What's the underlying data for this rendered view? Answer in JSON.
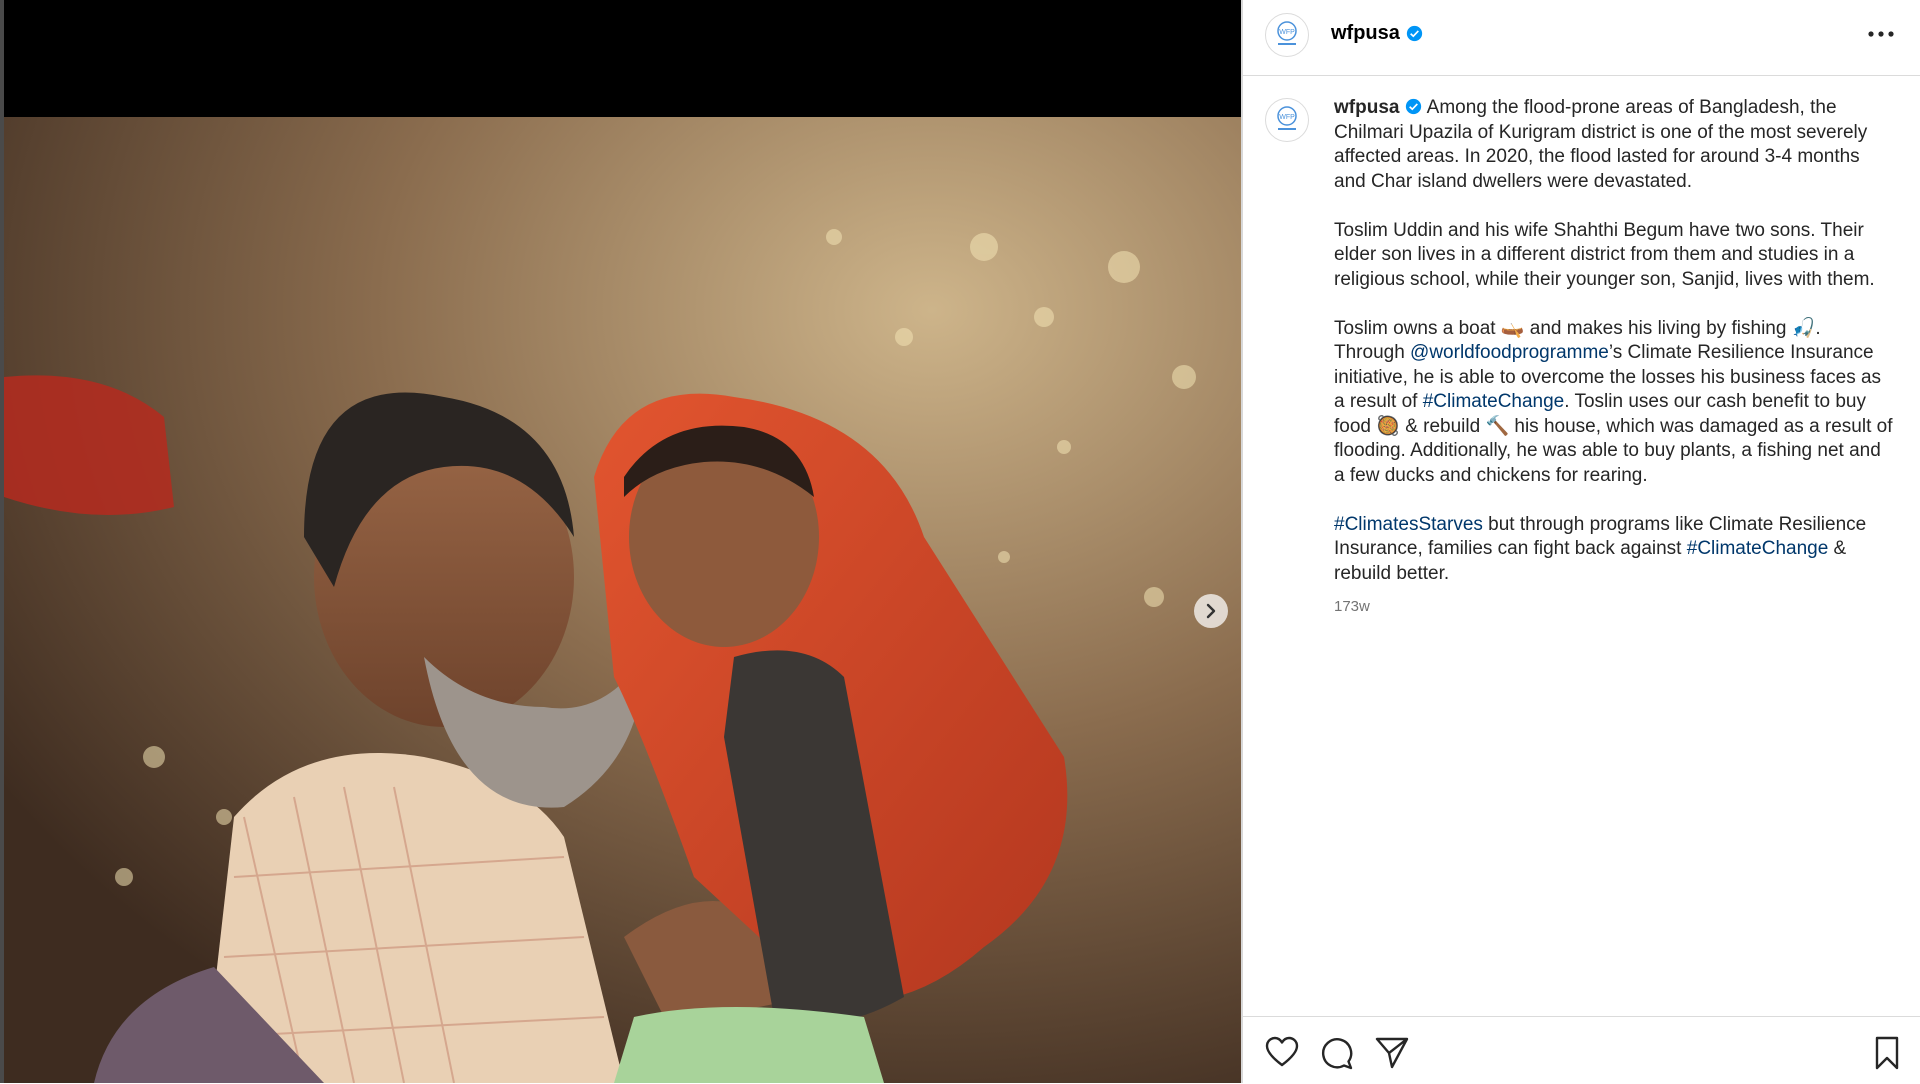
{
  "post": {
    "username": "wfpusa",
    "avatar_label": "WFP",
    "verified_icon": "verified-badge-icon",
    "more_icon": "more-options-icon",
    "next_icon": "chevron-right-icon",
    "caption": {
      "p1_after_name": " Among the flood-prone areas of Bangladesh, the Chilmari Upazila of Kurigram district is one of the most severely affected areas. In 2020, the flood lasted for around 3-4 months and Char island dwellers were devastated.",
      "p2": "Toslim Uddin and his wife Shahthi Begum have two sons. Their elder son lives in a different district from them and studies in a religious school, while their younger son, Sanjid, lives with them.",
      "p3": {
        "t1": "Toslim owns a boat 🛶 and makes his living by fishing 🎣. Through ",
        "mention": "@worldfoodprogramme",
        "t2": "’s Climate Resilience Insurance initiative, he is able to overcome the losses his business faces as a result of ",
        "hashtag1": "#ClimateChange",
        "t3": ". Toslin uses our cash benefit to buy food 🥘 & rebuild 🔨 his house, which was damaged as a result of flooding. Additionally, he was able to buy plants, a fishing net and a few ducks and chickens for rearing."
      },
      "p4": {
        "hashtag1": "#ClimatesStarves",
        "t1": " but through programs like Climate Resilience Insurance, families can fight back against ",
        "hashtag2": "#ClimateChange",
        "t2": " & rebuild better."
      }
    },
    "timestamp": "173w",
    "actions": [
      "heart-icon",
      "comment-icon",
      "share-icon",
      "bookmark-icon"
    ]
  },
  "colors": {
    "link": "#00376b",
    "verified": "#0095f6",
    "divider": "#dbdbdb",
    "timestamp": "#737373"
  }
}
